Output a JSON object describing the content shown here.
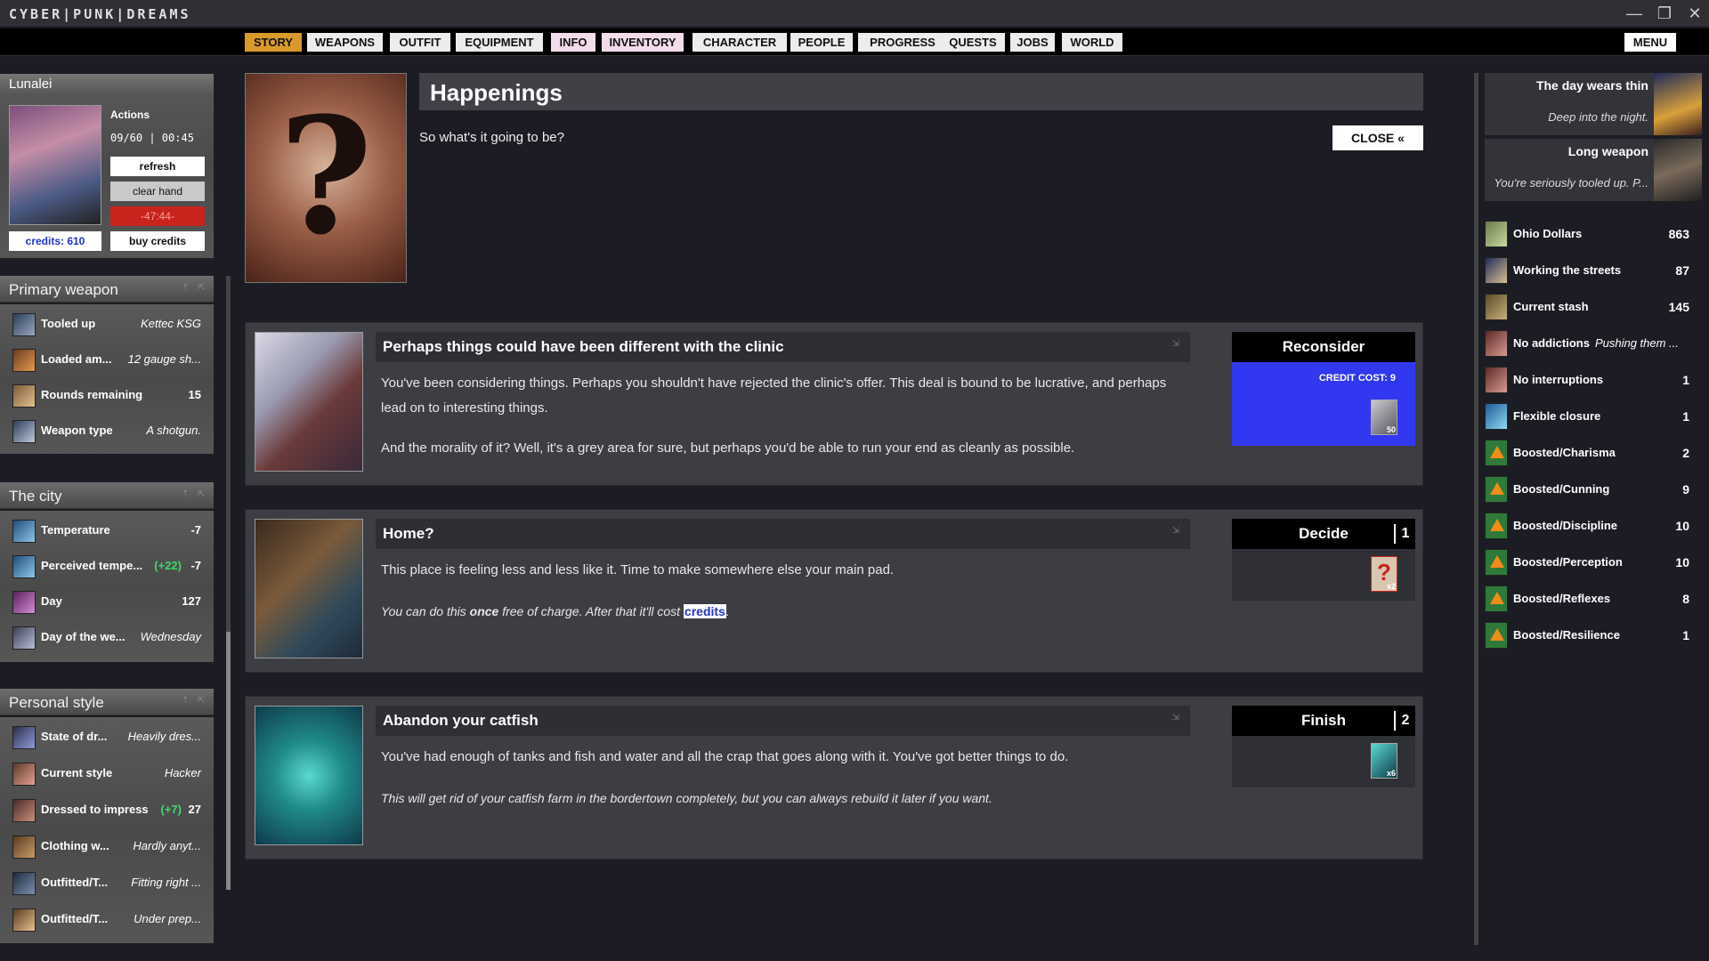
{
  "app": {
    "title": "CYBER|PUNK|DREAMS"
  },
  "window": {
    "minimize": "—",
    "maximize": "❐",
    "close": "✕"
  },
  "nav": {
    "tabs": [
      "STORY",
      "WEAPONS",
      "OUTFIT",
      "EQUIPMENT",
      "INFO",
      "INVENTORY",
      "CHARACTER",
      "PEOPLE",
      "PROGRESS",
      "QUESTS",
      "JOBS",
      "WORLD"
    ],
    "active": "STORY",
    "menu": "MENU"
  },
  "character": {
    "name": "Lunalei",
    "actions_label": "Actions",
    "actions_value": "09/60 | 00:45",
    "refresh": "refresh",
    "clear_hand": "clear hand",
    "timer": "-47:44-",
    "credits": "credits: 610",
    "buy_credits": "buy credits"
  },
  "primary_weapon": {
    "title": "Primary weapon",
    "rows": [
      {
        "label": "Tooled up",
        "value": "Kettec KSG"
      },
      {
        "label": "Loaded am...",
        "value": "12 gauge sh..."
      },
      {
        "label": "Rounds remaining",
        "value": "15"
      },
      {
        "label": "Weapon type",
        "value": "A shotgun."
      }
    ]
  },
  "city": {
    "title": "The city",
    "rows": [
      {
        "label": "Temperature",
        "extra": "",
        "value": "-7"
      },
      {
        "label": "Perceived tempe...",
        "extra": "(+22)",
        "value": "-7"
      },
      {
        "label": "Day",
        "extra": "",
        "value": "127"
      },
      {
        "label": "Day of the we...",
        "extra": "",
        "value": "Wednesday"
      }
    ]
  },
  "style": {
    "title": "Personal style",
    "rows": [
      {
        "label": "State of dr...",
        "extra": "",
        "value": "Heavily dres..."
      },
      {
        "label": "Current style",
        "extra": "",
        "value": "Hacker"
      },
      {
        "label": "Dressed to impress",
        "extra": "(+7)",
        "value": "27"
      },
      {
        "label": "Clothing w...",
        "extra": "",
        "value": "Hardly anyt..."
      },
      {
        "label": "Outfitted/T...",
        "extra": "",
        "value": "Fitting right ..."
      },
      {
        "label": "Outfitted/T...",
        "extra": "",
        "value": "Under prep..."
      }
    ]
  },
  "happenings": {
    "title": "Happenings",
    "subtitle": "So what's it going to be?",
    "close": "CLOSE «"
  },
  "events": [
    {
      "title": "Perhaps things could have been different with the clinic",
      "p1": "You've been considering things. Perhaps you shouldn't have rejected the clinic's offer. This deal is bound to be lucrative, and perhaps lead on to interesting things.",
      "p2": "And the morality of it? Well, it's a grey area for sure, but perhaps you'd be able to run your end as cleanly as possible.",
      "action": "Reconsider",
      "cost": "CREDIT COST: 9",
      "badge": "50"
    },
    {
      "title": "Home?",
      "p1": "This place is feeling less and less like it. Time to make somewhere else your main pad.",
      "p2_a": "You can do this ",
      "p2_b": "once",
      "p2_c": " free of charge. After that it'll cost ",
      "p2_link": "credits",
      "p2_d": ".",
      "action": "Decide",
      "count": "1",
      "badge": "x2"
    },
    {
      "title": "Abandon your catfish",
      "p1": "You've had enough of tanks and fish and water and all the crap that goes along with it. You've got better things to do.",
      "p2": "This will get rid of your catfish farm in the bordertown completely, but you can always rebuild it later if you want.",
      "action": "Finish",
      "count": "2",
      "badge": "x6"
    }
  ],
  "feed": [
    {
      "title": "The day wears thin",
      "sub": "Deep into the night."
    },
    {
      "title": "Long weapon",
      "sub": "You're seriously tooled up. P..."
    }
  ],
  "resources": [
    {
      "label": "Ohio Dollars",
      "sub": "",
      "value": "863"
    },
    {
      "label": "Working the streets",
      "sub": "",
      "value": "87"
    },
    {
      "label": "Current stash",
      "sub": "",
      "value": "145"
    },
    {
      "label": "No addictions",
      "sub": "Pushing them ...",
      "value": ""
    },
    {
      "label": "No interruptions",
      "sub": "",
      "value": "1"
    },
    {
      "label": "Flexible closure",
      "sub": "",
      "value": "1"
    },
    {
      "label": "Boosted/Charisma",
      "sub": "",
      "value": "2"
    },
    {
      "label": "Boosted/Cunning",
      "sub": "",
      "value": "9"
    },
    {
      "label": "Boosted/Discipline",
      "sub": "",
      "value": "10"
    },
    {
      "label": "Boosted/Perception",
      "sub": "",
      "value": "10"
    },
    {
      "label": "Boosted/Reflexes",
      "sub": "",
      "value": "8"
    },
    {
      "label": "Boosted/Resilience",
      "sub": "",
      "value": "1"
    }
  ],
  "colors": {
    "accent": "#d99a2b",
    "action_blue": "#3138f0",
    "timer_red": "#c8231c",
    "green": "#3fd96a",
    "boost_orange": "#f08c1a"
  }
}
